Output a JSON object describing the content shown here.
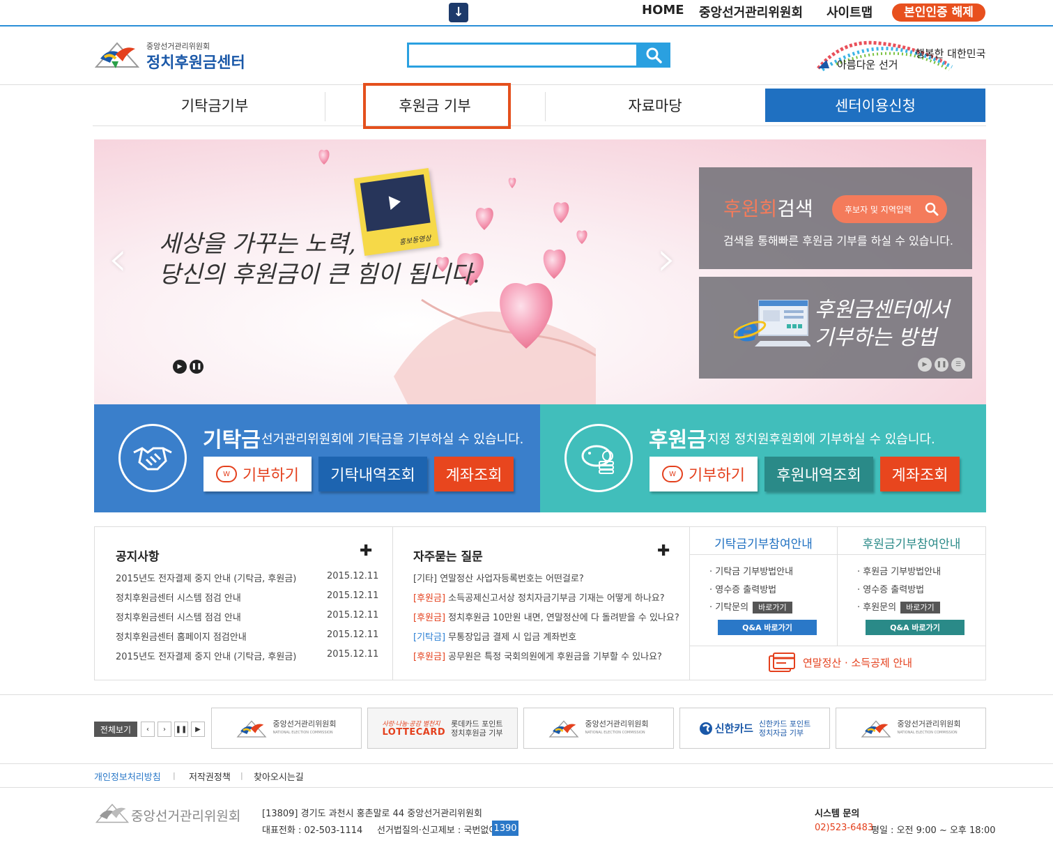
{
  "topbar": {
    "links": [
      "HOME",
      "중앙선거관리위원회",
      "사이트맵"
    ],
    "auth_button": "본인인증 해제"
  },
  "header": {
    "logo_sub": "중앙선거관리위원회",
    "logo_title": "정치후원금센터",
    "search_placeholder": "",
    "slogan_line1": "행복한 대한민국",
    "slogan_line2": "아름다운 선거"
  },
  "nav": {
    "items": [
      "기탁금기부",
      "후원금 기부",
      "자료마당"
    ],
    "center_button": "센터이용신청"
  },
  "banner": {
    "headline_line1": "세상을 가꾸는 노력,",
    "headline_line2": "당신의 후원금이 큰 힘이 됩니다.",
    "video_label": "홍보동영상",
    "search_panel": {
      "title_highlight": "후원회",
      "title_rest": "검색",
      "pill_label": "후보자 및 지역입력",
      "description": "검색을 통해빠른 후원금 기부를 하실 수 있습니다."
    },
    "guide_panel": {
      "line1": "후원금센터에서",
      "line2": "기부하는 방법"
    }
  },
  "donation": {
    "left": {
      "title": "기탁금",
      "description": "선거관리위원회에 기탁금을 기부하실 수 있습니다.",
      "buttons": [
        "기부하기",
        "기탁내역조회",
        "계좌조회"
      ]
    },
    "right": {
      "title": "후원금",
      "description": "지정 정치원후원회에 기부하실 수 있습니다.",
      "buttons": [
        "기부하기",
        "후원내역조회",
        "계좌조회"
      ]
    },
    "won_icon": "W"
  },
  "notice": {
    "title": "공지사항",
    "items": [
      {
        "text": "2015년도 전자결제 중지 안내 (기탁금, 후원금)",
        "date": "2015.12.11"
      },
      {
        "text": "정치후원금센터 시스템 점검 안내",
        "date": "2015.12.11"
      },
      {
        "text": "정치후원금센터 시스템 점검 안내",
        "date": "2015.12.11"
      },
      {
        "text": "정치후원금센터 홈페이지 점검안내",
        "date": "2015.12.11"
      },
      {
        "text": "2015년도 전자결제 중지 안내 (기탁금, 후원금)",
        "date": "2015.12.11"
      }
    ]
  },
  "faq": {
    "title": "자주묻는 질문",
    "items": [
      {
        "tag": "[기타]",
        "text": "연말정산 사업자등록번호는 어떤걸로?",
        "tag_color": "plain"
      },
      {
        "tag": "[후원금]",
        "text": "소득공제신고서상 정치자금기부금 기재는 어떻게 하나요?",
        "tag_color": "red"
      },
      {
        "tag": "[후원금]",
        "text": "정치후원금 10만원 내면, 연말정산에 다 돌려받을 수 있나요?",
        "tag_color": "red"
      },
      {
        "tag": "[기탁금]",
        "text": "무통장입금 결제 시 입금 계좌번호",
        "tag_color": "blue"
      },
      {
        "tag": "[후원금]",
        "text": "공무원은 특정 국회의원에게 후원금을 기부할 수 있나요?",
        "tag_color": "red"
      }
    ]
  },
  "guides": {
    "left": {
      "title": "기탁금기부참여안내",
      "items": [
        "기탁금 기부방법안내",
        "영수증 출력방법",
        "기탁문의"
      ],
      "go_label": "바로가기",
      "qa_label": "Q&A 바로가기"
    },
    "right": {
      "title": "후원금기부참여안내",
      "items": [
        "후원금 기부방법안내",
        "영수증 출력방법",
        "후원문의"
      ],
      "go_label": "바로가기",
      "qa_label": "Q&A 바로가기"
    },
    "tax_notice": "연말정산 · 소득공제 안내"
  },
  "partners": {
    "view_all": "전체보기",
    "banners": [
      {
        "line1": "중앙선거관리위원회",
        "line2": "NATIONAL ELECTION COMMISSION"
      },
      {
        "line1": "롯데카드 포인트",
        "line2": "정치후원금 기부",
        "brand": "LOTTECARD",
        "brand_small": "사랑·나눔·공감 별천지"
      },
      {
        "line1": "중앙선거관리위원회",
        "line2": "NATIONAL ELECTION COMMISSION"
      },
      {
        "line1": "신한카드 포인트",
        "line2": "정치자금 기부",
        "brand": "신한카드"
      },
      {
        "line1": "중앙선거관리위원회",
        "line2": "NATIONAL ELECTION COMMISSION"
      }
    ]
  },
  "footer": {
    "links": [
      "개인정보처리방침",
      "저작권정책",
      "찾아오시는길"
    ],
    "logo_text": "중앙선거관리위원회",
    "address": "[13809] 경기도 과천시 홍촌말로 44 중앙선거관리위원회",
    "phone": "대표전화 : 02-503-1114",
    "report": "선거법질의·신고제보 : 국번없이",
    "report_number": "1390",
    "system_title": "시스템 문의",
    "system_phone": "02)523-6483",
    "system_hours": "평일 : 오전 9:00 ~ 오후 18:00"
  },
  "colors": {
    "brand_blue": "#1f70c1",
    "accent_orange": "#e4501d",
    "teal": "#41bebb",
    "donation_blue": "#3a7fcb"
  }
}
